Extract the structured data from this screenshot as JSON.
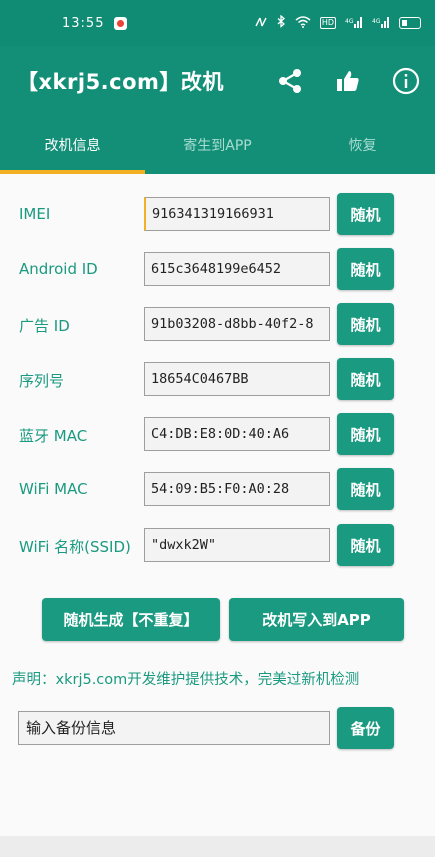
{
  "status_bar": {
    "time": "13:55",
    "icons": [
      "nfc-icon",
      "bluetooth-icon",
      "wifi-icon",
      "hd-icon",
      "signal-icon",
      "signal-icon",
      "battery-icon"
    ],
    "hd_label": "HD",
    "net_label_1": "4G",
    "net_label_2": "4G"
  },
  "app_bar": {
    "title": "【xkrj5.com】改机",
    "actions": [
      "share-icon",
      "thumbs-up-icon",
      "info-icon"
    ]
  },
  "tabs": [
    {
      "label": "改机信息",
      "active": true
    },
    {
      "label": "寄生到APP",
      "active": false
    },
    {
      "label": "恢复",
      "active": false
    }
  ],
  "fields": [
    {
      "label": "IMEI",
      "value": "916341319166931",
      "button": "随机"
    },
    {
      "label": "Android ID",
      "value": "615c3648199e6452",
      "button": "随机"
    },
    {
      "label": "广告 ID",
      "value": "91b03208-d8bb-40f2-8",
      "button": "随机"
    },
    {
      "label": "序列号",
      "value": "18654C0467BB",
      "button": "随机"
    },
    {
      "label": "蓝牙 MAC",
      "value": "C4:DB:E8:0D:40:A6",
      "button": "随机"
    },
    {
      "label": "WiFi MAC",
      "value": "54:09:B5:F0:A0:28",
      "button": "随机"
    },
    {
      "label": "WiFi 名称(SSID)",
      "value": "\"dwxk2W\"",
      "button": "随机"
    }
  ],
  "actions": {
    "random_generate": "随机生成【不重复】",
    "write_to_app": "改机写入到APP"
  },
  "notice": "声明：xkrj5.com开发维护提供技术，完美过新机检测",
  "backup": {
    "placeholder": "输入备份信息",
    "button": "备份"
  },
  "colors": {
    "primary": "#138f78",
    "accent": "#f4b023",
    "button": "#1a9a80"
  }
}
